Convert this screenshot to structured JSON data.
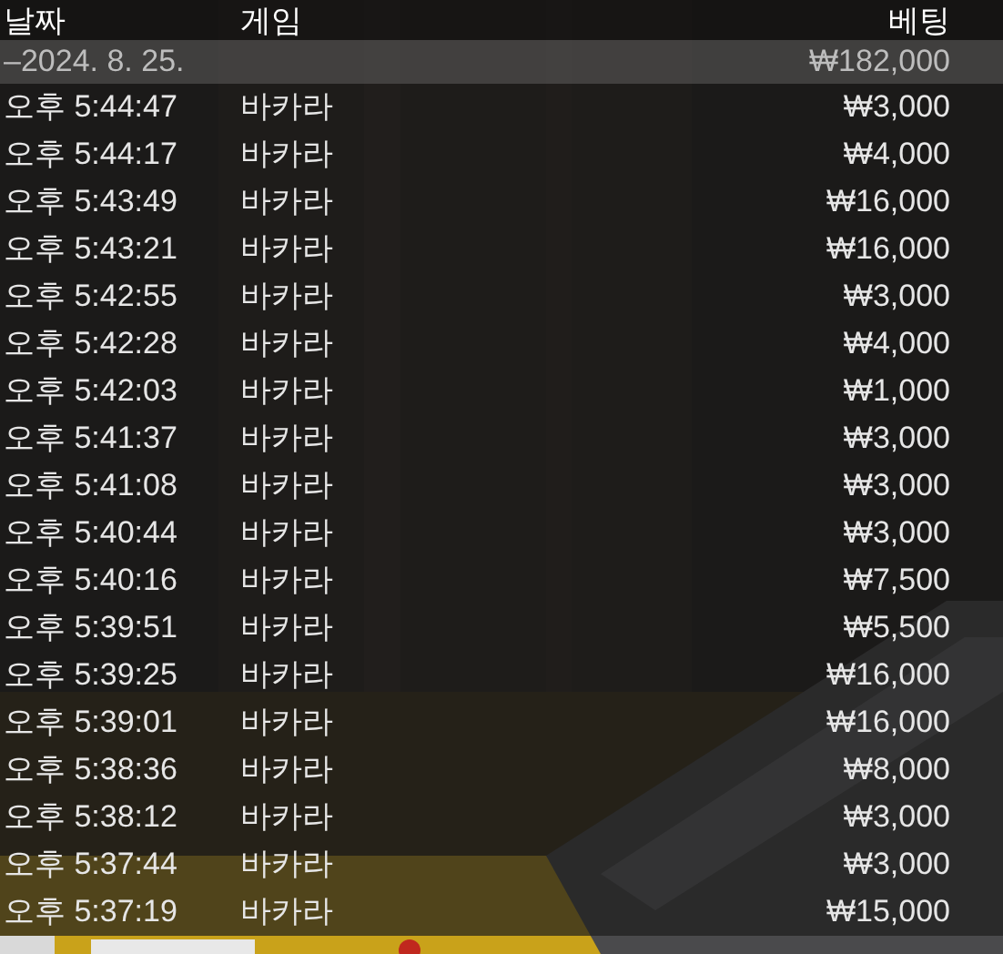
{
  "columns": [
    "날짜",
    "게임",
    "베팅"
  ],
  "group": {
    "date": "–2024. 8. 25.",
    "total": "₩182,000"
  },
  "rows": [
    {
      "time": "오후 5:44:47",
      "game": "바카라",
      "bet": "₩3,000"
    },
    {
      "time": "오후 5:44:17",
      "game": "바카라",
      "bet": "₩4,000"
    },
    {
      "time": "오후 5:43:49",
      "game": "바카라",
      "bet": "₩16,000"
    },
    {
      "time": "오후 5:43:21",
      "game": "바카라",
      "bet": "₩16,000"
    },
    {
      "time": "오후 5:42:55",
      "game": "바카라",
      "bet": "₩3,000"
    },
    {
      "time": "오후 5:42:28",
      "game": "바카라",
      "bet": "₩4,000"
    },
    {
      "time": "오후 5:42:03",
      "game": "바카라",
      "bet": "₩1,000"
    },
    {
      "time": "오후 5:41:37",
      "game": "바카라",
      "bet": "₩3,000"
    },
    {
      "time": "오후 5:41:08",
      "game": "바카라",
      "bet": "₩3,000"
    },
    {
      "time": "오후 5:40:44",
      "game": "바카라",
      "bet": "₩3,000"
    },
    {
      "time": "오후 5:40:16",
      "game": "바카라",
      "bet": "₩7,500"
    },
    {
      "time": "오후 5:39:51",
      "game": "바카라",
      "bet": "₩5,500"
    },
    {
      "time": "오후 5:39:25",
      "game": "바카라",
      "bet": "₩16,000"
    },
    {
      "time": "오후 5:39:01",
      "game": "바카라",
      "bet": "₩16,000"
    },
    {
      "time": "오후 5:38:36",
      "game": "바카라",
      "bet": "₩8,000"
    },
    {
      "time": "오후 5:38:12",
      "game": "바카라",
      "bet": "₩3,000"
    },
    {
      "time": "오후 5:37:44",
      "game": "바카라",
      "bet": "₩3,000"
    },
    {
      "time": "오후 5:37:19",
      "game": "바카라",
      "bet": "₩15,000"
    }
  ]
}
